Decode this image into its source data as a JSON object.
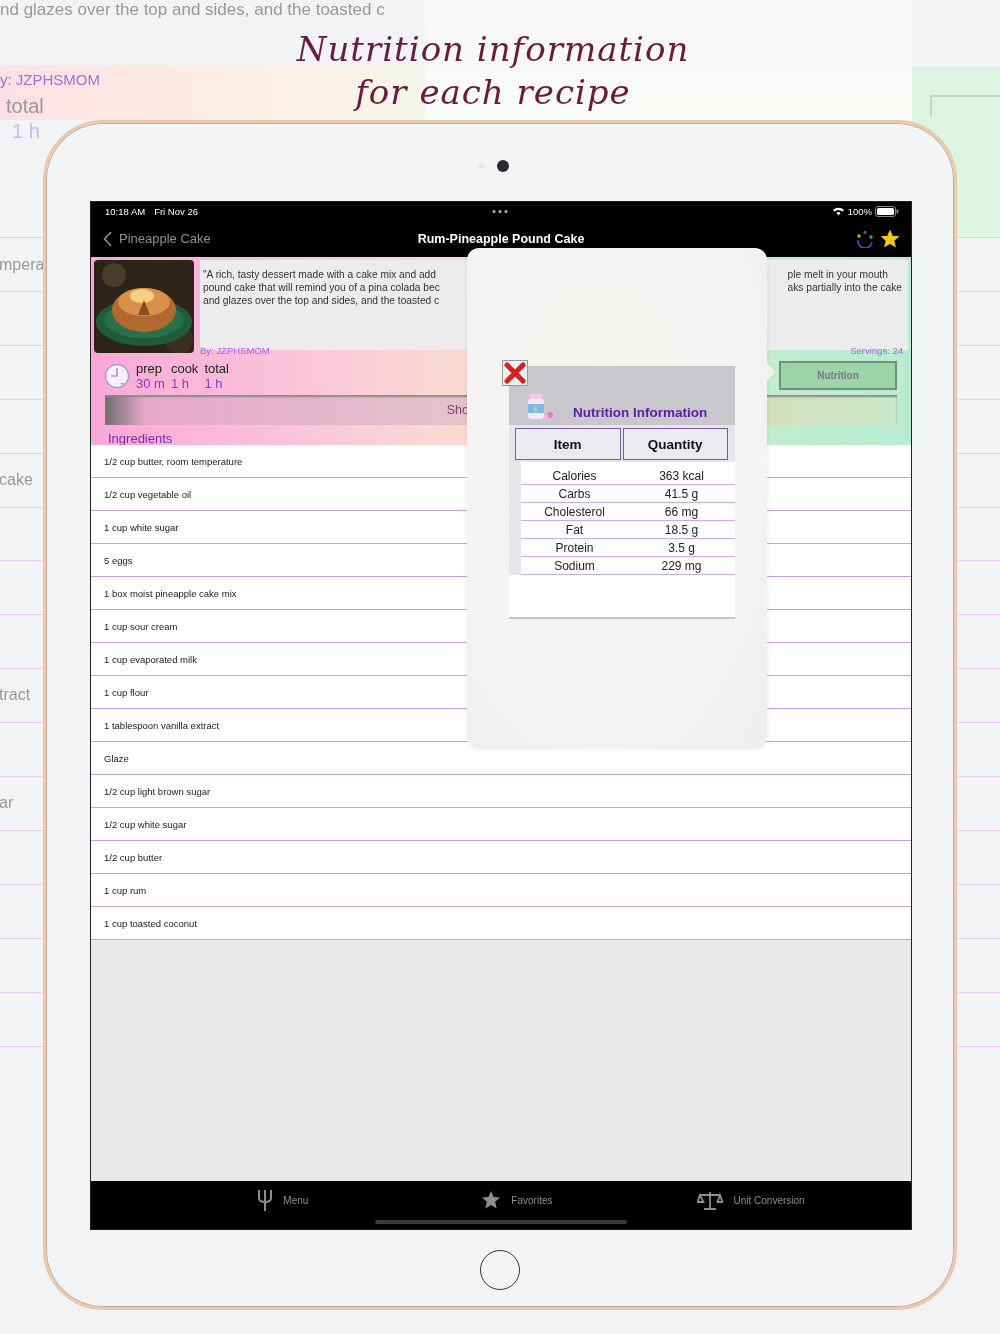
{
  "promo": {
    "headline": [
      "Nutrition information",
      "for each recipe"
    ]
  },
  "background": {
    "top_text": "nd glazes over the top and sides, and the toasted c",
    "author": "y: JZPHSMOM",
    "time_label": "total",
    "time_value": "1 h",
    "row_fragments": [
      "mpera",
      "cake",
      "tract",
      "ar"
    ]
  },
  "status_bar": {
    "time": "10:18 AM",
    "date": "Fri Nov 26",
    "battery": "100%"
  },
  "nav_bar": {
    "back": "Pineapple Cake",
    "title": "Rum-Pineapple Pound Cake",
    "favorite": true
  },
  "recipe": {
    "description_left": [
      "\"A rich, tasty dessert made with a cake mix and add",
      "pound cake that will remind you of a pina colada bec",
      "and glazes over the top and sides, and the toasted c"
    ],
    "description_right": [
      "ple melt in your mouth",
      "aks partially into the cake"
    ],
    "author": "By: JZPHSMOM",
    "servings": "Servings: 24",
    "times": [
      {
        "label": "prep",
        "value": "30 m"
      },
      {
        "label": "cook",
        "value": "1 h"
      },
      {
        "label": "total",
        "value": "1 h"
      }
    ],
    "show_button": "Sho",
    "nutrition_button": "Nutrition",
    "ingredients_heading": "Ingredients",
    "ingredients": [
      "1/2 cup butter, room temperature",
      "1/2 cup vegetable oil",
      "1 cup white sugar",
      "5 eggs",
      "1 box moist pineapple cake mix",
      "1 cup sour cream",
      "1 cup evaporated milk",
      "1 cup flour",
      "1 tablespoon vanilla extract",
      "Glaze",
      "1/2 cup light brown sugar",
      "1/2 cup white sugar",
      "1/2 cup butter",
      "1 cup rum",
      "1 cup toasted coconut"
    ]
  },
  "popover": {
    "title": "Nutrition Information",
    "columns": [
      "Item",
      "Quantity"
    ],
    "rows": [
      [
        "Calories",
        "363 kcal"
      ],
      [
        "Carbs",
        "41.5 g"
      ],
      [
        "Cholesterol",
        "66 mg"
      ],
      [
        "Fat",
        "18.5 g"
      ],
      [
        "Protein",
        "3.5 g"
      ],
      [
        "Sodium",
        "229 mg"
      ]
    ]
  },
  "tab_bar": [
    {
      "label": "Menu",
      "kind": "fork"
    },
    {
      "label": "Favorites",
      "kind": "star"
    },
    {
      "label": "Unit Conversion",
      "kind": "scale"
    }
  ]
}
